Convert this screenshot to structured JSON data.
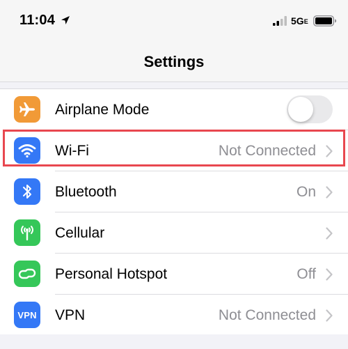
{
  "status_bar": {
    "time": "11:04",
    "network": "5G",
    "network_suffix": "E"
  },
  "nav": {
    "title": "Settings"
  },
  "rows": [
    {
      "label": "Airplane Mode",
      "value": "",
      "icon": "airplane-icon",
      "icon_color": "#f19a37",
      "toggle_on": false
    },
    {
      "label": "Wi-Fi",
      "value": "Not Connected",
      "icon": "wifi-icon",
      "icon_color": "#3478f6"
    },
    {
      "label": "Bluetooth",
      "value": "On",
      "icon": "bluetooth-icon",
      "icon_color": "#3478f6"
    },
    {
      "label": "Cellular",
      "value": "",
      "icon": "cellular-antenna-icon",
      "icon_color": "#35c759"
    },
    {
      "label": "Personal Hotspot",
      "value": "Off",
      "icon": "hotspot-icon",
      "icon_color": "#35c759"
    },
    {
      "label": "VPN",
      "value": "Not Connected",
      "icon": "vpn-icon",
      "icon_color": "#3478f6",
      "icon_text": "VPN"
    }
  ],
  "highlight_color": "#e8474f"
}
